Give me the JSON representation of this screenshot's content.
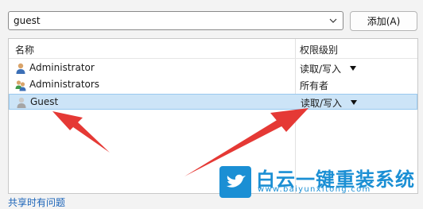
{
  "search": {
    "value": "guest"
  },
  "add_button": {
    "label": "添加(A)"
  },
  "table": {
    "columns": {
      "name": "名称",
      "permission": "权限级别"
    },
    "rows": [
      {
        "name": "Administrator",
        "permission": "读取/写入",
        "has_dropdown": true,
        "icon": "user-icon",
        "selected": false
      },
      {
        "name": "Administrators",
        "permission": "所有者",
        "has_dropdown": false,
        "icon": "user-group-icon",
        "selected": false
      },
      {
        "name": "Guest",
        "permission": "读取/写入",
        "has_dropdown": true,
        "icon": "guest-user-icon",
        "selected": true
      }
    ]
  },
  "help_link": "共享时有问题",
  "watermark": {
    "brand": "白云一键重装系统",
    "url": "www.baiyunxitong.com"
  },
  "colors": {
    "selection": "#cce4f7",
    "arrow": "#e53935",
    "brand": "#1b8fd4"
  }
}
